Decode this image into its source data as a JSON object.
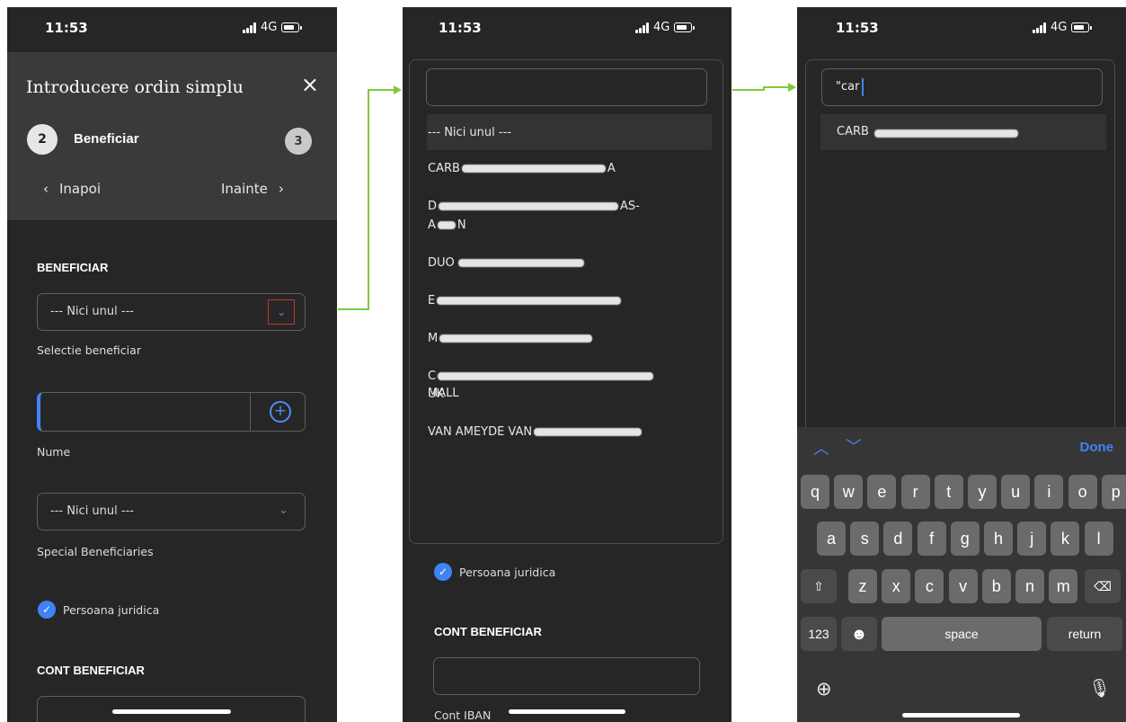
{
  "status": {
    "time": "11:53",
    "network": "4G"
  },
  "screen1": {
    "title": "Introducere ordin simplu",
    "close_icon": "×",
    "step_current": "2",
    "step_current_label": "Beneficiar",
    "step_next": "3",
    "back_label": "Inapoi",
    "next_label": "Inainte",
    "section_beneficiar": "BENEFICIAR",
    "select_value": "--- Nici unul ---",
    "select_caption": "Selectie beneficiar",
    "name_caption": "Nume",
    "special_value": "--- Nici unul ---",
    "special_caption": "Special Beneficiaries",
    "checkbox_label": "Persoana juridica",
    "section_cont": "CONT BENEFICIAR"
  },
  "screen2": {
    "search_value": "",
    "items": [
      {
        "visible": "--- Nici unul ---",
        "tail": ""
      },
      {
        "visible": "CARB",
        "tail": "A"
      },
      {
        "visible": "D",
        "tail": "AS-"
      },
      {
        "visible": "A",
        "tail": "N"
      },
      {
        "visible": "DUO",
        "tail": ""
      },
      {
        "visible": "E",
        "tail": ""
      },
      {
        "visible": "M",
        "tail": ""
      },
      {
        "visible": "C",
        "tail": "UK"
      },
      {
        "visible": "MALL",
        "tail": ""
      },
      {
        "visible": "VAN AMEYDE VAN",
        "tail": ""
      }
    ],
    "checkbox_label": "Persoana juridica",
    "section_cont": "CONT BENEFICIAR",
    "iban_caption": "Cont IBAN"
  },
  "screen3": {
    "search_value": "\"car",
    "result_visible": "CARB",
    "keyboard": {
      "done": "Done",
      "row1": [
        "q",
        "w",
        "e",
        "r",
        "t",
        "y",
        "u",
        "i",
        "o",
        "p"
      ],
      "row2": [
        "a",
        "s",
        "d",
        "f",
        "g",
        "h",
        "j",
        "k",
        "l"
      ],
      "row3": [
        "z",
        "x",
        "c",
        "v",
        "b",
        "n",
        "m"
      ],
      "num": "123",
      "space": "space",
      "return": "return"
    }
  },
  "colors": {
    "accent": "#3f84f5",
    "arrow": "#7ecb3a",
    "highlight": "#c0392b"
  }
}
